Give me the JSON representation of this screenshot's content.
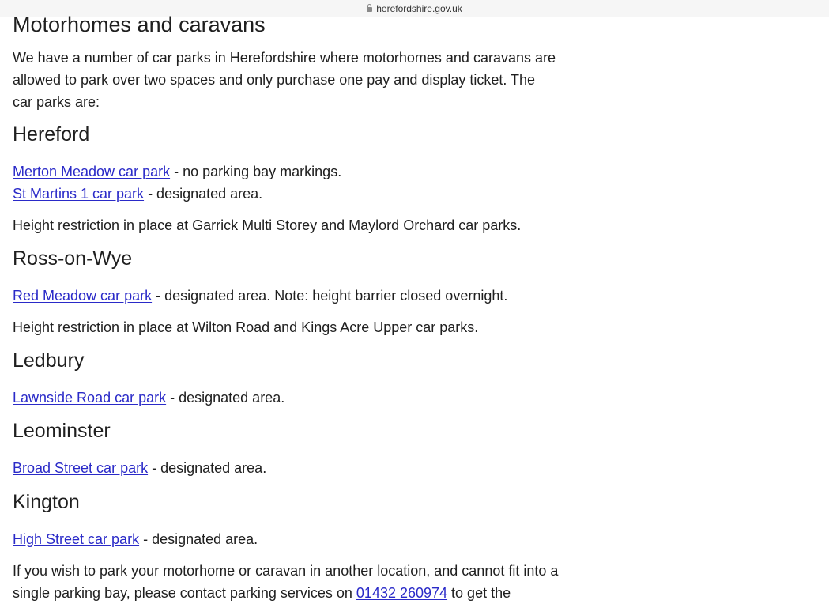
{
  "browser": {
    "url": "herefordshire.gov.uk"
  },
  "page": {
    "title": "Motorhomes and caravans",
    "intro": "We have a number of car parks in Herefordshire where motorhomes and caravans are allowed to park over two spaces and only purchase one pay and display ticket. The car parks are:",
    "sections": [
      {
        "heading": "Hereford",
        "entries": [
          {
            "link": "Merton Meadow car park",
            "text": " - no parking bay markings."
          },
          {
            "link": "St Martins 1 car park",
            "text": " - designated area."
          }
        ],
        "note": "Height restriction in place at Garrick Multi Storey and Maylord Orchard car parks."
      },
      {
        "heading": "Ross-on-Wye",
        "entries": [
          {
            "link": "Red Meadow car park",
            "text": " - designated area. Note: height barrier closed overnight."
          }
        ],
        "note": "Height restriction in place at Wilton Road and Kings Acre Upper car parks."
      },
      {
        "heading": "Ledbury",
        "entries": [
          {
            "link": "Lawnside Road car park",
            "text": " - designated area."
          }
        ]
      },
      {
        "heading": "Leominster",
        "entries": [
          {
            "link": "Broad Street car park",
            "text": " - designated area."
          }
        ]
      },
      {
        "heading": "Kington",
        "entries": [
          {
            "link": "High Street car park",
            "text": " - designated area."
          }
        ]
      }
    ],
    "footer_line1": "If you wish to park your motorhome or caravan in another location, and cannot fit into a",
    "footer_line2_start": "single parking bay, please contact parking services on ",
    "footer_phone": "01432 260974",
    "footer_line2_end": " to get the"
  }
}
